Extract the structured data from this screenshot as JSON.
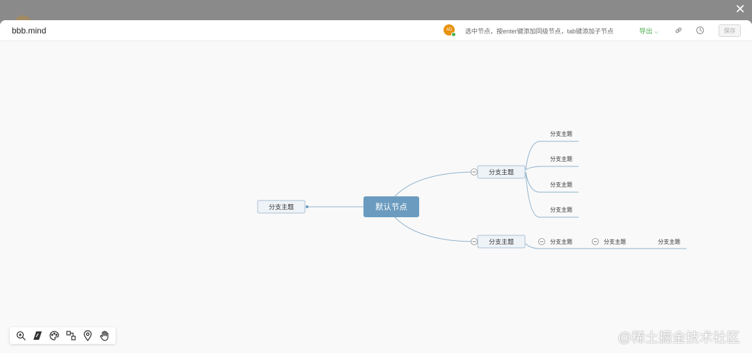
{
  "file": {
    "title": "bbb.mind"
  },
  "user": {
    "initials": "AD"
  },
  "hint": "选中节点，按enter键添加同级节点，tab键添加子节点",
  "toolbar": {
    "export_label": "导出",
    "save_label": "保存"
  },
  "mindmap": {
    "root": "默认节点",
    "left_branch": "分支主题",
    "right_upper": "分支主题",
    "right_upper_children": [
      "分支主题",
      "分支主题",
      "分支主题",
      "分支主题"
    ],
    "right_lower": "分支主题",
    "right_lower_chain": [
      "分支主题",
      "分支主题",
      "分支主题"
    ]
  },
  "watermark": "@稀土掘金技术社区",
  "colors": {
    "accent": "#6b9bbf",
    "node_border": "#a9c0d3",
    "export": "#4caf50",
    "line": "#8fb2cc"
  },
  "icons": [
    "close-icon",
    "link-icon",
    "history-icon",
    "zoom-in-icon",
    "fit-view-icon",
    "theme-icon",
    "structure-icon",
    "location-icon",
    "hand-icon"
  ]
}
